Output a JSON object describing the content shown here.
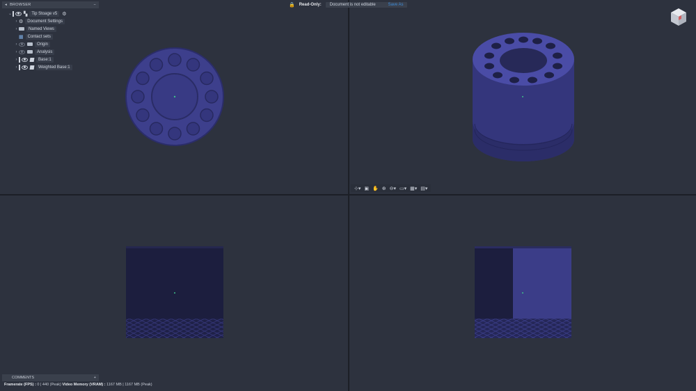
{
  "browser": {
    "title": "BROWSER",
    "items": [
      {
        "label": "Tip Stoage v5"
      },
      {
        "label": "Document Settings"
      },
      {
        "label": "Named Views"
      },
      {
        "label": "Contact sets"
      },
      {
        "label": "Origin"
      },
      {
        "label": "Analysis"
      },
      {
        "label": "Base:1"
      },
      {
        "label": "Weighted Base:1"
      }
    ]
  },
  "banner": {
    "readonly_label": "Read-Only:",
    "message": "Document is not editable",
    "link": "Save As"
  },
  "comments": {
    "title": "COMMENTS"
  },
  "status": {
    "fps_label": "Framerate (FPS) :",
    "fps_value": "0 | 440 (Peak)",
    "vram_label": "Video Memory (VRAM) :",
    "vram_value": "1167 MB | 1167 MB (Peak)"
  },
  "colors": {
    "model": "#3d3f8c",
    "model_dark": "#1f2148",
    "viewport_bg": "#2d323e",
    "accent_lock": "#f0b530",
    "link": "#3d8bd9"
  },
  "icons": [
    "collapse-icon",
    "eye-icon",
    "folder-icon",
    "gear-icon",
    "body-icon",
    "lock-icon",
    "viewcube-icon",
    "orbit-icon",
    "pan-icon",
    "zoom-icon",
    "display-icon",
    "grid-icon"
  ]
}
